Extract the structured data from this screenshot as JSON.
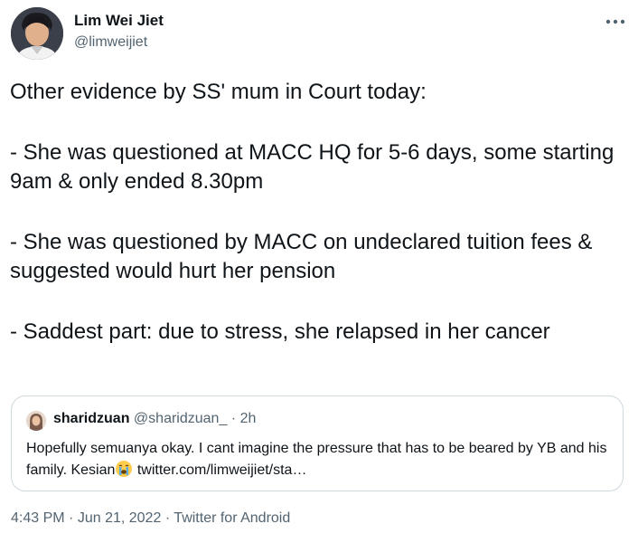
{
  "author": {
    "name": "Lim Wei Jiet",
    "handle": "@limweijiet"
  },
  "more_icon": "more-horizontal-icon",
  "tweet": {
    "lines": [
      "Other evidence by SS' mum in Court today:",
      "- She was questioned at MACC HQ for 5-6 days, some starting 9am & only ended 8.30pm",
      "- She was questioned by MACC on undeclared tuition fees & suggested would hurt her pension",
      "- Saddest part: due to stress, she relapsed in her cancer"
    ]
  },
  "quoted_tweet": {
    "name": "sharidzuan",
    "handle": "@sharidzuan_",
    "separator": "·",
    "time": "2h",
    "text_before_emoji": "Hopefully semuanya okay. I cant imagine the pressure that has to be beared by YB and his family. Kesian",
    "emoji": "loudly-crying-face-emoji",
    "link": "twitter.com/limweijiet/sta…"
  },
  "meta": {
    "time": "4:43 PM",
    "sep1": "·",
    "date": "Jun 21, 2022",
    "sep2": "·",
    "source": "Twitter for Android"
  }
}
